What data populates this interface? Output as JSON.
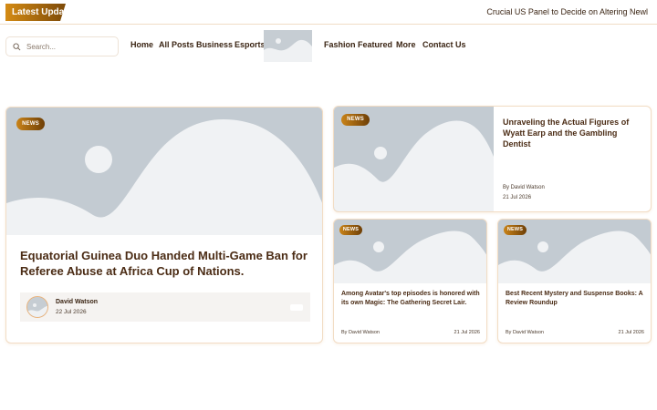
{
  "topbar": {
    "latest_label": "Latest Update",
    "ticker_text": "Crucial US Panel to Decide on Altering Newl"
  },
  "search": {
    "placeholder": "Search..."
  },
  "nav": [
    {
      "label": "Home"
    },
    {
      "label": "All Posts"
    },
    {
      "label": "Business"
    },
    {
      "label": "Esports"
    },
    {
      "label": "Fashion"
    },
    {
      "label": "Featured"
    },
    {
      "label": "More"
    },
    {
      "label": "Contact Us"
    }
  ],
  "colors": {
    "accent": "#c98318",
    "accent_dark": "#6e3f07",
    "placeholder_bg": "#c3cbd2",
    "border": "#f2dcc4"
  },
  "featured": {
    "badge": "NEWS",
    "title": "Equatorial Guinea Duo Handed Multi-Game Ban for Referee Abuse at Africa Cup of Nations.",
    "author": "David Watson",
    "date": "22 Jul 2026"
  },
  "side_top": {
    "badge": "NEWS",
    "title": "Unraveling the Actual Figures of Wyatt Earp and the Gambling Dentist",
    "author": "By David Watson",
    "date": "21 Jul 2026"
  },
  "small_cards": [
    {
      "badge": "NEWS",
      "title": "Among Avatar's top episodes is honored with its own Magic: The Gathering Secret Lair.",
      "author": "By David Watson",
      "date": "21 Jul 2026"
    },
    {
      "badge": "NEWS",
      "title": "Best Recent Mystery and Suspense Books: A Review Roundup",
      "author": "By David Watson",
      "date": "21 Jul 2026"
    }
  ]
}
